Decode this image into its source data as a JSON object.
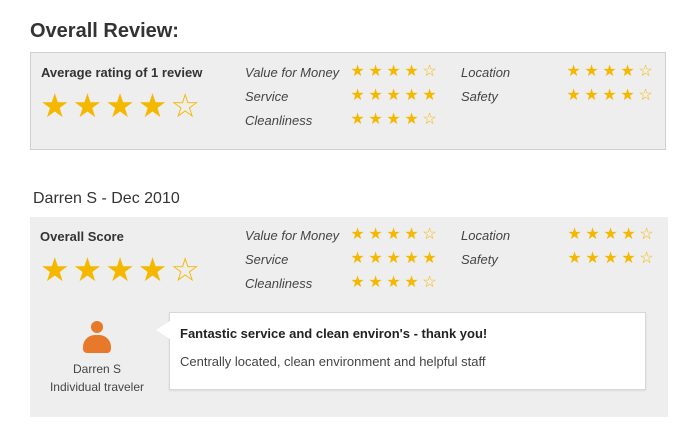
{
  "page": {
    "title": "Overall Review:"
  },
  "summary": {
    "heading": "Average rating of 1 review",
    "overall_rating": 4,
    "criteria": [
      {
        "label": "Value for Money",
        "rating": 4
      },
      {
        "label": "Service",
        "rating": 5
      },
      {
        "label": "Cleanliness",
        "rating": 4
      },
      {
        "label": "Location",
        "rating": 4
      },
      {
        "label": "Safety",
        "rating": 4
      }
    ]
  },
  "review": {
    "heading": "Darren S - Dec 2010",
    "score_label": "Overall Score",
    "overall_rating": 4,
    "criteria": [
      {
        "label": "Value for Money",
        "rating": 4
      },
      {
        "label": "Service",
        "rating": 5
      },
      {
        "label": "Cleanliness",
        "rating": 4
      },
      {
        "label": "Location",
        "rating": 4
      },
      {
        "label": "Safety",
        "rating": 4
      }
    ],
    "reviewer_name": "Darren S",
    "reviewer_type": "Individual traveler",
    "title": "Fantastic service and clean environ's - thank you!",
    "body": "Centrally located, clean environment and helpful staff"
  },
  "colors": {
    "star": "#f5b800",
    "avatar": "#e8782a",
    "panel": "#eeeeee"
  },
  "icons": {
    "star": "star-icon",
    "avatar": "person-icon"
  }
}
